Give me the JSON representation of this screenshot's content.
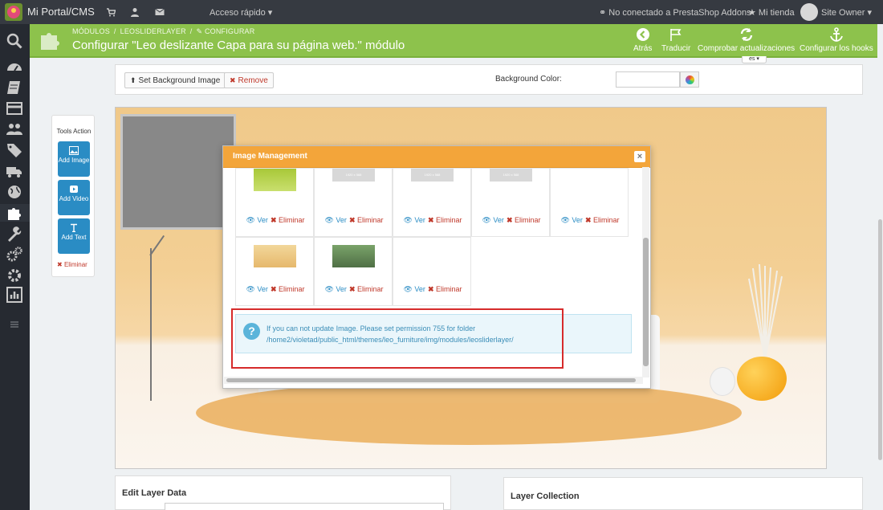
{
  "topbar": {
    "brand": "Mi Portal/CMS",
    "quick_access": "Acceso rápido ▾",
    "addons_status": "No conectado a PrestaShop Addons",
    "my_store": "Mi tienda",
    "owner": "Site Owner ▾"
  },
  "header": {
    "breadcrumbs": [
      "MÓDULOS",
      "/",
      "LEOSLIDERLAYER",
      "/",
      "CONFIGURAR"
    ],
    "title": "Configurar \"Leo deslizante Capa para su página web.\" módulo",
    "actions": [
      {
        "label": "Atrás",
        "icon": "back-circle-icon"
      },
      {
        "label": "Traducir",
        "icon": "flag-icon"
      },
      {
        "label": "Comprobar actualizaciones",
        "icon": "refresh-icon"
      },
      {
        "label": "Configurar los hooks",
        "icon": "anchor-icon"
      }
    ],
    "language": "es ▾"
  },
  "background_panel": {
    "set_bg_label": "Set Background Image",
    "remove_label": "Remove",
    "bg_color_label": "Background Color:",
    "bg_color_value": ""
  },
  "tools": {
    "title": "Tools Action",
    "add_image": "Add Image",
    "add_video": "Add Video",
    "add_text": "Add Text",
    "delete": "Eliminar"
  },
  "modal": {
    "title": "Image Management",
    "close": "×",
    "view_label": "Ver",
    "delete_label": "Eliminar",
    "placeholder_text": "1920 x 568",
    "images_row1": [
      "lime-interior",
      "placeholder",
      "placeholder",
      "placeholder",
      "empty"
    ],
    "images_row2": [
      "beige-interior",
      "green-interior",
      "empty"
    ],
    "notice": "If you can not update Image. Please set permission 755 for folder /home2/violetad/public_html/themes/leo_furniture/img/modules/leosliderlayer/"
  },
  "edit_layer": {
    "title": "Edit Layer Data"
  },
  "layer_collection": {
    "title": "Layer Collection"
  },
  "colors": {
    "header_green": "#8dc24c",
    "modal_orange": "#f3a53a",
    "tool_blue": "#2a8cc4",
    "danger_red": "#c0392b"
  }
}
